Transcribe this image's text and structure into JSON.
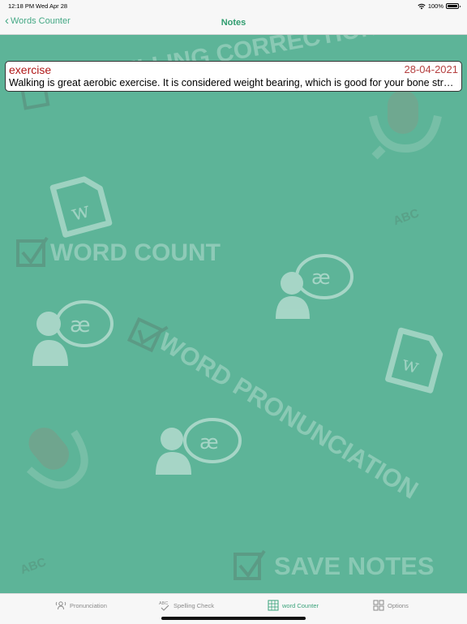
{
  "status_bar": {
    "time": "12:18 PM",
    "date": "Wed Apr 28",
    "battery": "100%",
    "battery_level": 1.0
  },
  "nav": {
    "back_label": "Words Counter",
    "title": "Notes"
  },
  "watermark": {
    "spelling": "SPELLING CORRECTION",
    "word_count": "WORD COUNT",
    "word_pronunciation": "WORD PRONUNCIATION",
    "save_notes": "SAVE NOTES",
    "abc": "ABC",
    "ae": "æ"
  },
  "notes": [
    {
      "title": "exercise",
      "date": "28-04-2021",
      "body": "Walking is great aerobic exercise. It is considered weight bearing, which is good for your bone strength."
    }
  ],
  "tabs": [
    {
      "label": "Pronunciation",
      "icon": "pronunciation-icon",
      "active": false
    },
    {
      "label": "Spelling Check",
      "icon": "spelling-check-icon",
      "active": false
    },
    {
      "label": "word Counter",
      "icon": "word-counter-icon",
      "active": true
    },
    {
      "label": "Options",
      "icon": "options-grid-icon",
      "active": false
    }
  ],
  "colors": {
    "accent": "#3aa37b",
    "background": "#5db498",
    "note_title": "#b01818",
    "note_date": "#b54040"
  }
}
